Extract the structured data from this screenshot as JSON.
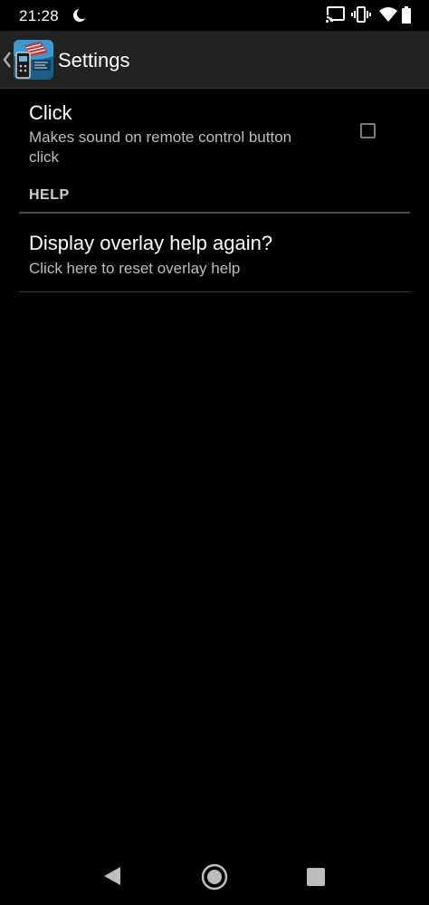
{
  "status_bar": {
    "time": "21:28"
  },
  "app_bar": {
    "title": "Settings"
  },
  "preferences": {
    "click": {
      "title": "Click",
      "summary_line1": "Makes sound on remote control button",
      "summary_line2": "click",
      "checked": false
    },
    "help_category": "HELP",
    "overlay_help": {
      "title": "Display overlay help again?",
      "summary": "Click here to reset overlay help"
    }
  },
  "colors": {
    "background": "#000000",
    "app_bar": "#222222",
    "summary_text": "#bdbdbd"
  }
}
